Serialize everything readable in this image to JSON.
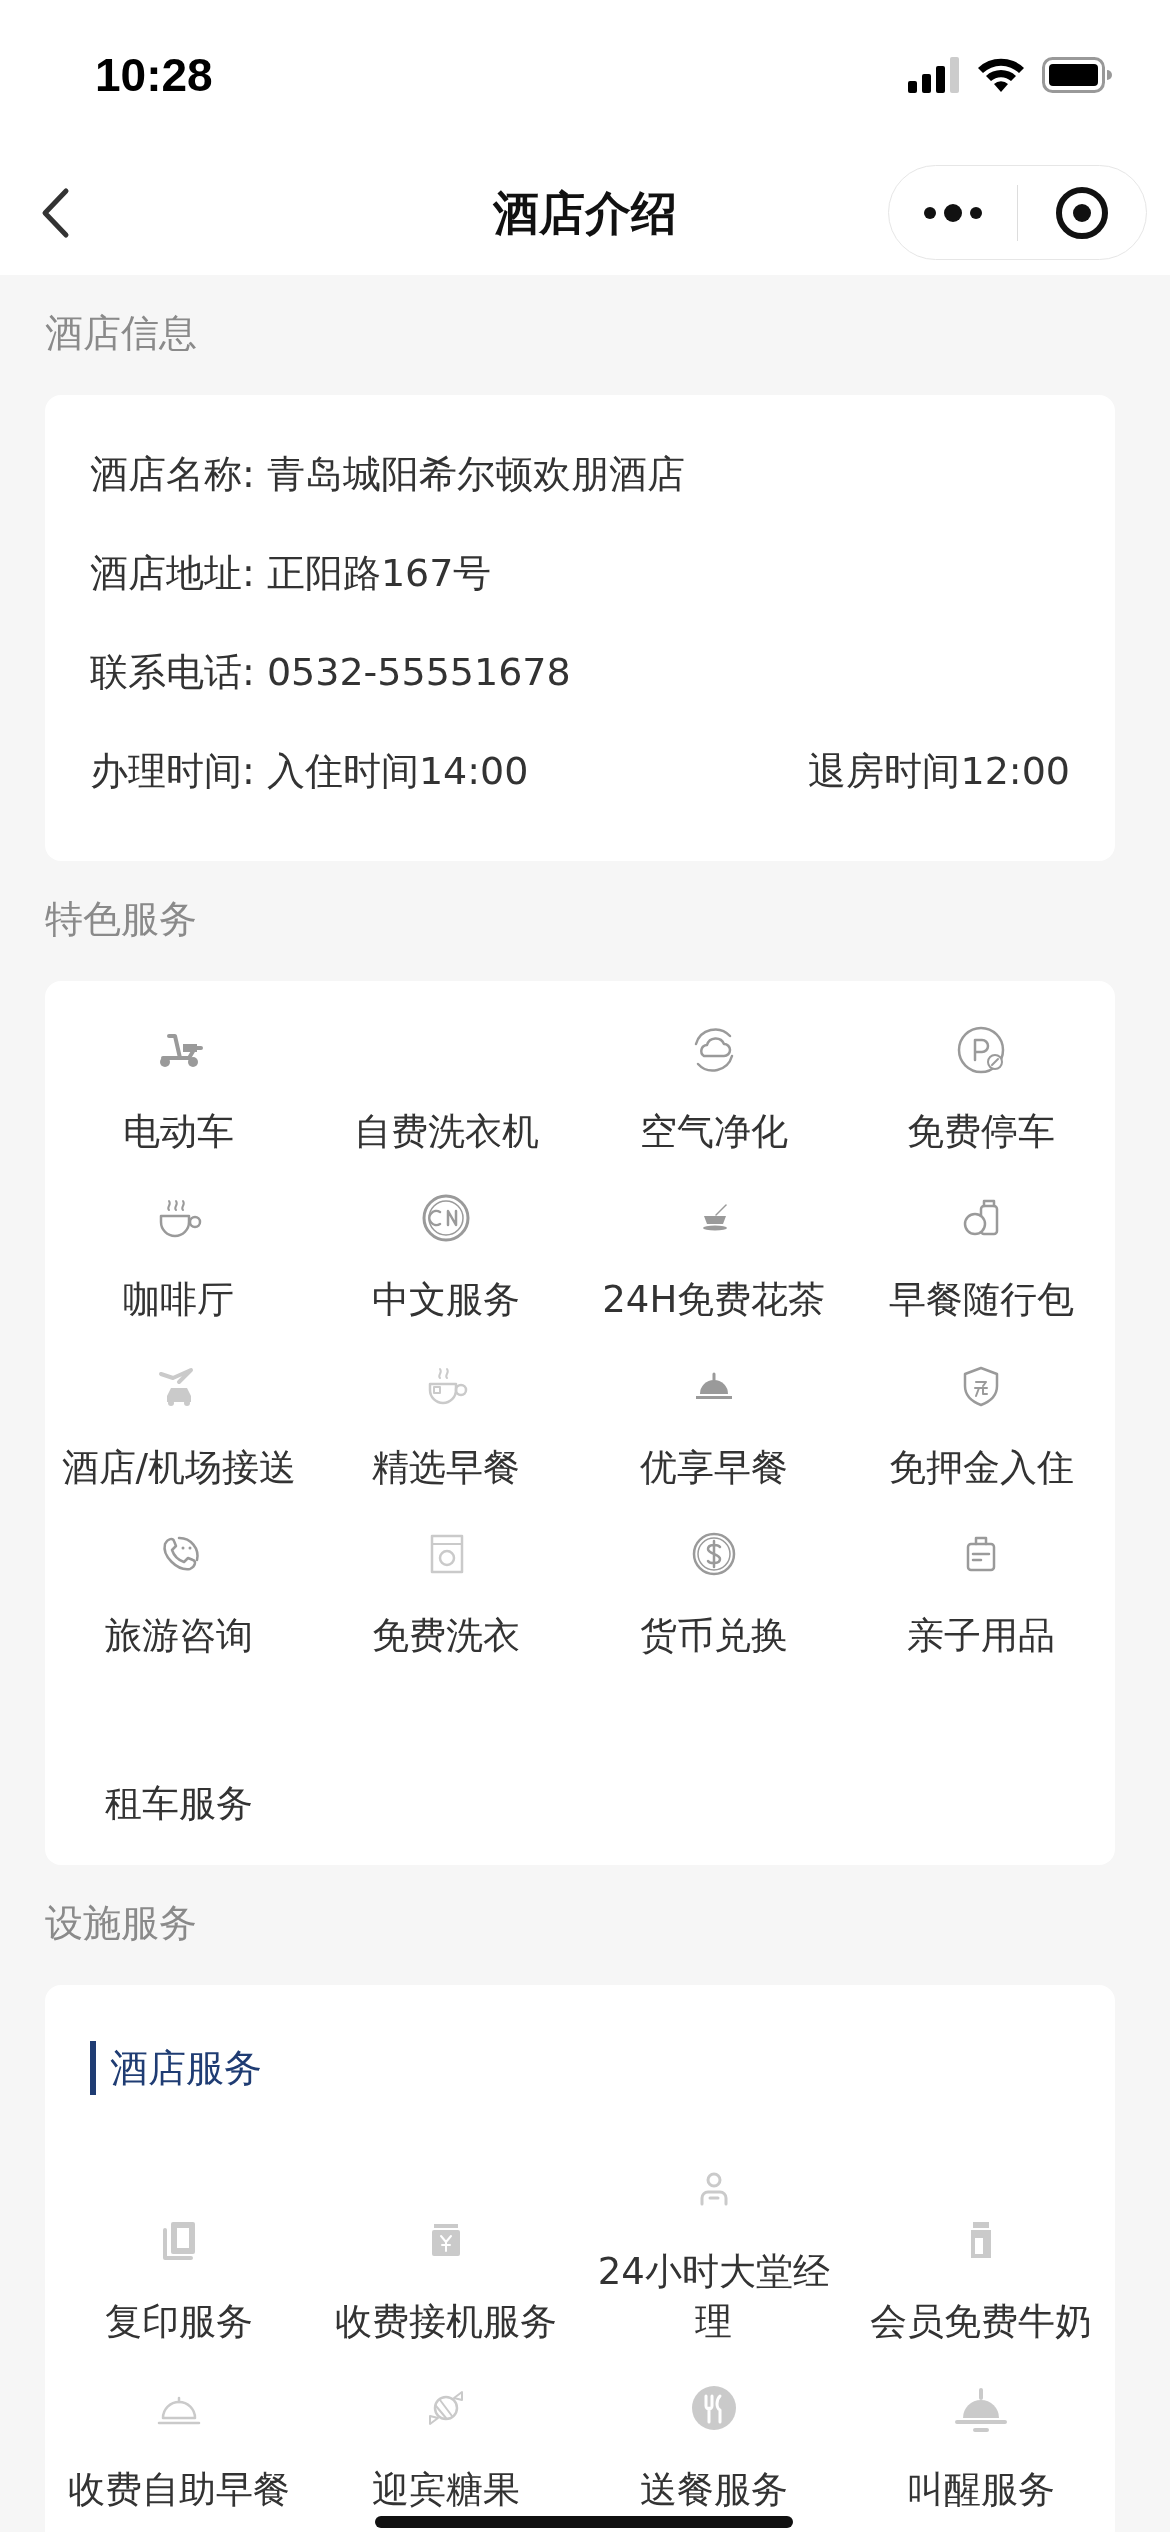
{
  "status_bar": {
    "time": "10:28"
  },
  "nav": {
    "title": "酒店介绍"
  },
  "hotel_info": {
    "heading": "酒店信息",
    "rows": [
      {
        "text": "酒店名称: 青岛城阳希尔顿欢朋酒店"
      },
      {
        "text": "酒店地址: 正阳路167号"
      },
      {
        "text": "联系电话: 0532-55551678"
      },
      {
        "text": "办理时间: 入住时间14:00",
        "right": "退房时间12:00"
      }
    ]
  },
  "special_services": {
    "heading": "特色服务",
    "items": [
      "电动车",
      "自费洗衣机",
      "空气净化",
      "免费停车",
      "咖啡厅",
      "中文服务",
      "24H免费花茶",
      "早餐随行包",
      "酒店/机场接送",
      "精选早餐",
      "优享早餐",
      "免押金入住",
      "旅游咨询",
      "免费洗衣",
      "货币兑换",
      "亲子用品",
      "租车服务"
    ]
  },
  "facilities": {
    "heading": "设施服务",
    "group": {
      "title": "酒店服务",
      "items": [
        "复印服务",
        "收费接机服务",
        "24小时大堂经理",
        "会员免费牛奶",
        "收费自助早餐",
        "迎宾糖果",
        "送餐服务",
        "叫醒服务"
      ]
    }
  }
}
